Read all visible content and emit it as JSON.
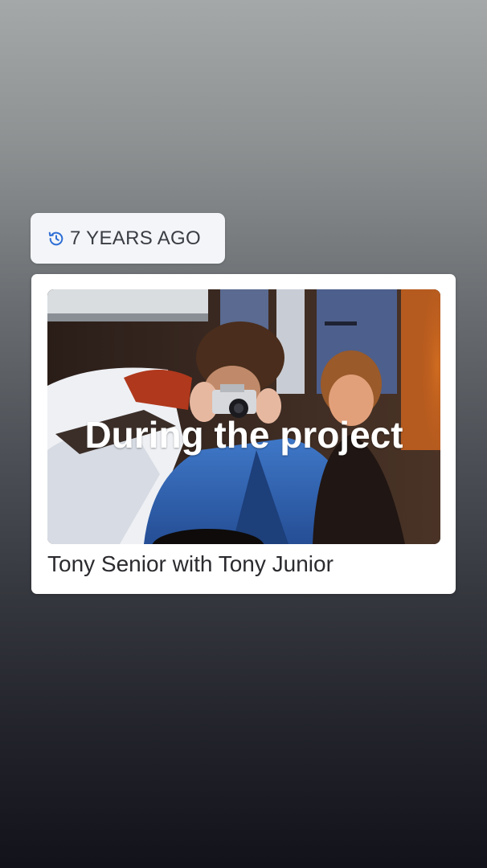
{
  "memory": {
    "time_label": "7 YEARS AGO",
    "time_icon": "history-icon",
    "accent_color": "#2f6fd6"
  },
  "post": {
    "overlay_text": "During the project",
    "caption": "Tony Senior with Tony Junior"
  }
}
